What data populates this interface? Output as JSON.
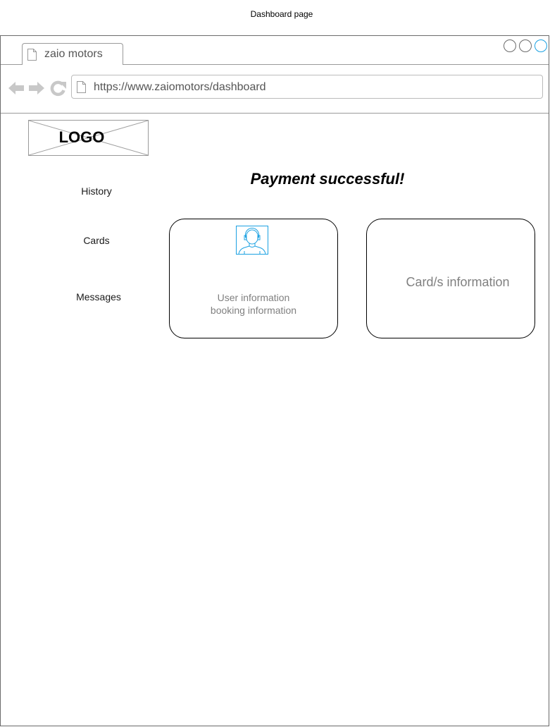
{
  "page_caption": "Dashboard page",
  "browser": {
    "tab_title": "zaio motors",
    "url": "https://www.zaiomotors/dashboard",
    "accent_color": "#1ba1e2"
  },
  "logo": {
    "text": "LOGO"
  },
  "sidebar": {
    "items": [
      {
        "label": "History"
      },
      {
        "label": "Cards"
      },
      {
        "label": "Messages"
      }
    ]
  },
  "main": {
    "heading": "Payment successful!",
    "user_card": {
      "line1": "User information",
      "line2": "booking information"
    },
    "cards_card": {
      "label": "Card/s information"
    }
  }
}
